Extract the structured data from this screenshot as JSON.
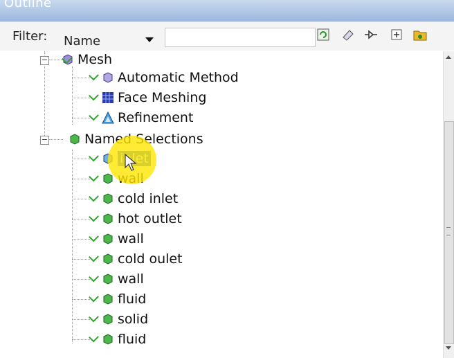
{
  "panel": {
    "title": "Outline"
  },
  "toolbar": {
    "filter_label": "Filter:",
    "filter_value": "Name",
    "search_value": "",
    "icons": [
      "refresh-icon",
      "clear-filter-icon",
      "collapse-environments-icon",
      "expand-all-icon",
      "folder-icon"
    ]
  },
  "tree": {
    "mesh": {
      "label": "Mesh",
      "children": [
        "Automatic Method",
        "Face Meshing",
        "Refinement"
      ]
    },
    "named_selections": {
      "label": "Named Selections",
      "children": [
        "inlet",
        "wall",
        "cold inlet",
        "hot outlet",
        "wall",
        "cold oulet",
        "wall",
        "fluid",
        "solid",
        "fluid"
      ],
      "selected_index": 0
    }
  },
  "colors": {
    "selection": "#3d7fd6",
    "check": "#2fa52f",
    "highlight": "#ffe600"
  }
}
